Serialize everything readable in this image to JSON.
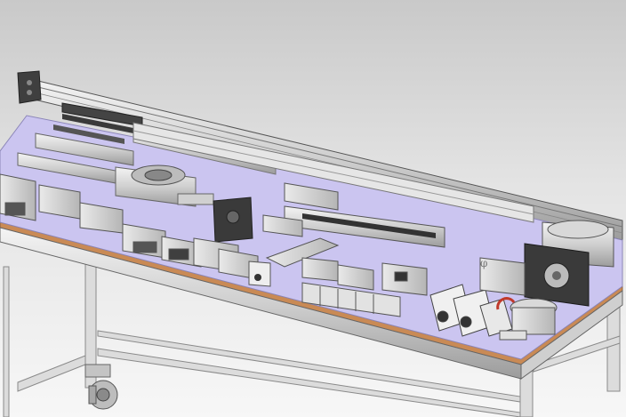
{
  "viewport": {
    "model": "pneumatic-components-demo-bench",
    "background_top": "#c9c9c9",
    "background_bottom": "#f7f7f7",
    "tabletop_color": "#cbc5f0",
    "tabletop_edge_color": "#c98a55",
    "frame_color": "#dcdcdc",
    "accent_red": "#c0392b",
    "handwritten_label": "φ"
  }
}
